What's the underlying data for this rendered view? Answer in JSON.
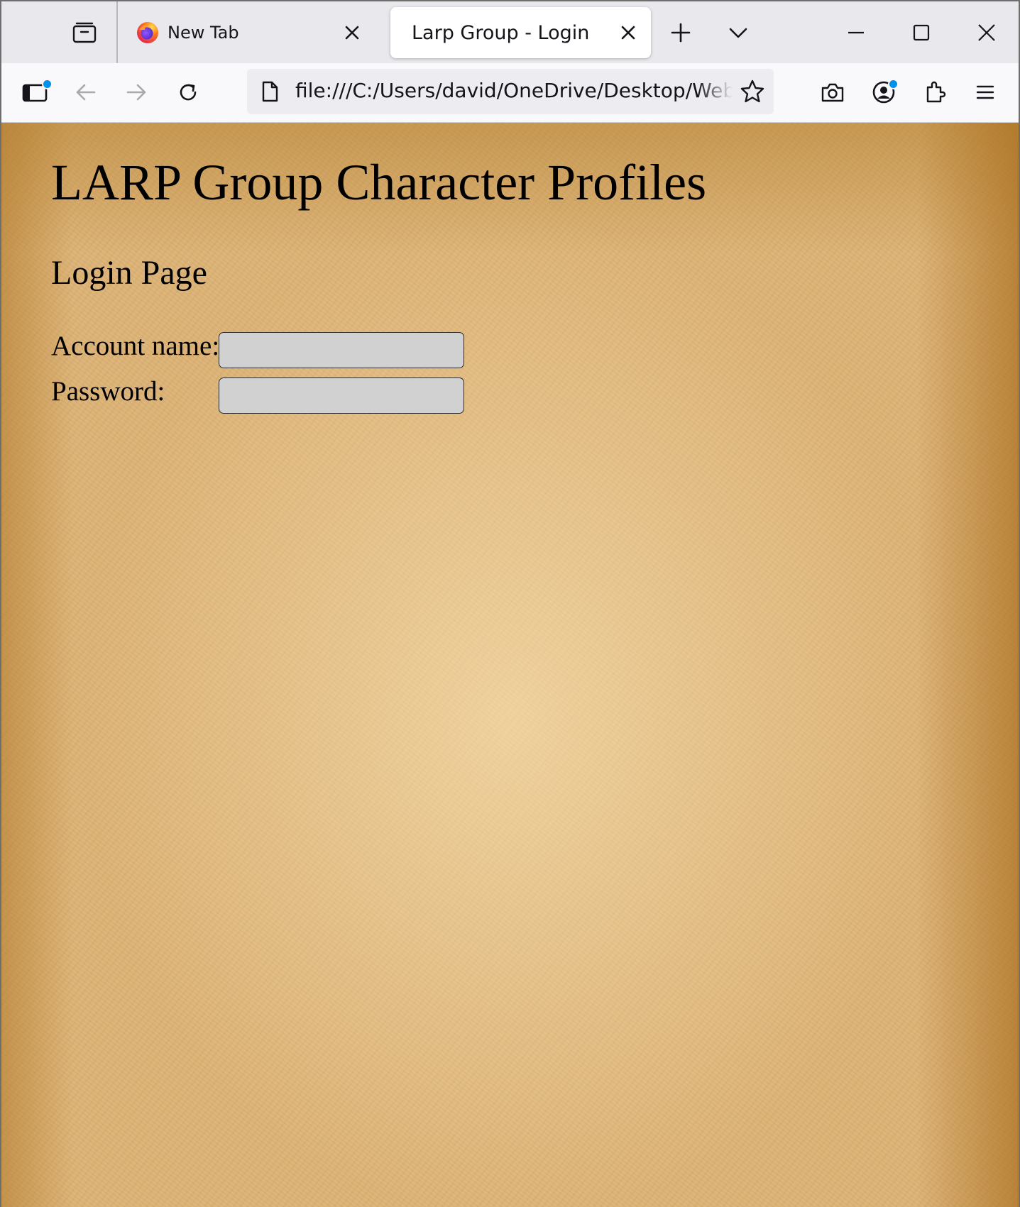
{
  "browser": {
    "tabs": [
      {
        "title": "New Tab",
        "active": false,
        "favicon": "firefox-icon"
      },
      {
        "title": "Larp Group - Login",
        "active": true
      }
    ],
    "url": "file:///C:/Users/david/OneDrive/Desktop/WebDesign",
    "accent_color": "#0090ed",
    "icons": [
      "tab-overview-icon",
      "close-icon",
      "plus-icon",
      "chevron-down-icon",
      "minimize-icon",
      "maximize-icon",
      "window-close-icon",
      "sidebar-icon",
      "back-arrow-icon",
      "forward-arrow-icon",
      "reload-icon",
      "page-icon",
      "bookmark-star-icon",
      "screenshot-camera-icon",
      "account-icon",
      "extensions-icon",
      "menu-icon"
    ]
  },
  "page": {
    "site_title": "LARP Group Character Profiles",
    "page_title": "Login Page",
    "form": {
      "account_label": "Account name:",
      "account_value": "",
      "password_label": "Password:",
      "password_value": ""
    },
    "background": "parchment",
    "background_color": "#dcb275",
    "input_color": "#d1d1d1"
  }
}
